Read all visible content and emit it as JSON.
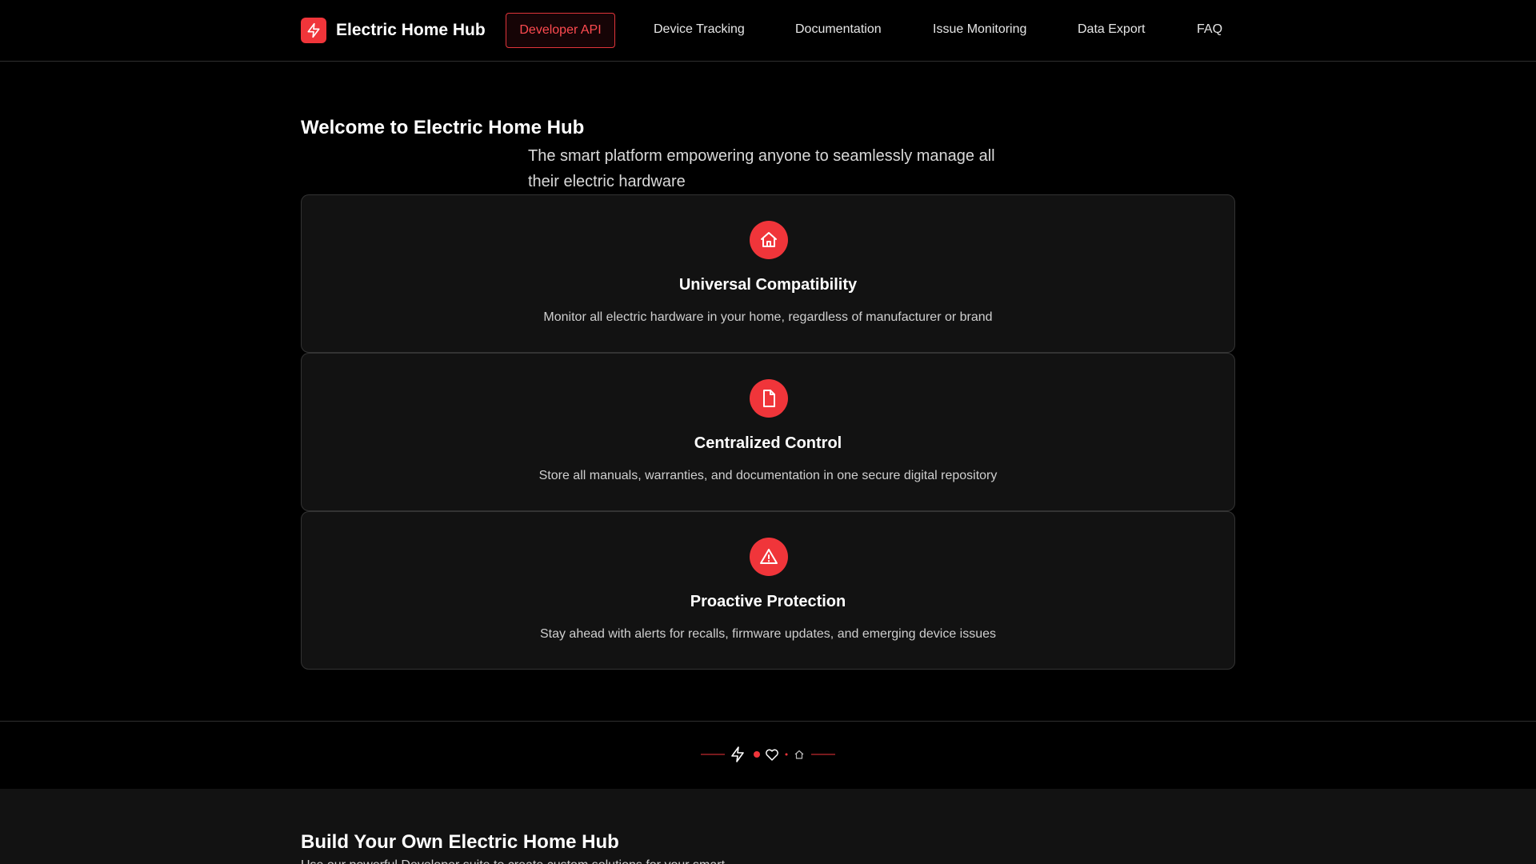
{
  "header": {
    "brand": "Electric Home Hub",
    "nav": {
      "developer_api": "Developer API",
      "device_tracking": "Device Tracking",
      "documentation": "Documentation",
      "issue_monitoring": "Issue Monitoring",
      "data_export": "Data Export",
      "faq": "FAQ"
    }
  },
  "hero": {
    "title": "Welcome to Electric Home Hub",
    "subtitle": "The smart platform empowering anyone to seamlessly manage all their electric hardware"
  },
  "features": [
    {
      "icon": "home-icon",
      "title": "Universal Compatibility",
      "text": "Monitor all electric hardware in your home, regardless of manufacturer or brand"
    },
    {
      "icon": "document-icon",
      "title": "Centralized Control",
      "text": "Store all manuals, warranties, and documentation in one secure digital repository"
    },
    {
      "icon": "warning-icon",
      "title": "Proactive Protection",
      "text": "Stay ahead with alerts for recalls, firmware updates, and emerging device issues"
    }
  ],
  "build": {
    "title": "Build Your Own Electric Home Hub",
    "subtitle": "Use our powerful Developer suite to create custom solutions for your smart"
  },
  "colors": {
    "accent": "#f0353a",
    "background": "#000000",
    "card": "#121212"
  }
}
